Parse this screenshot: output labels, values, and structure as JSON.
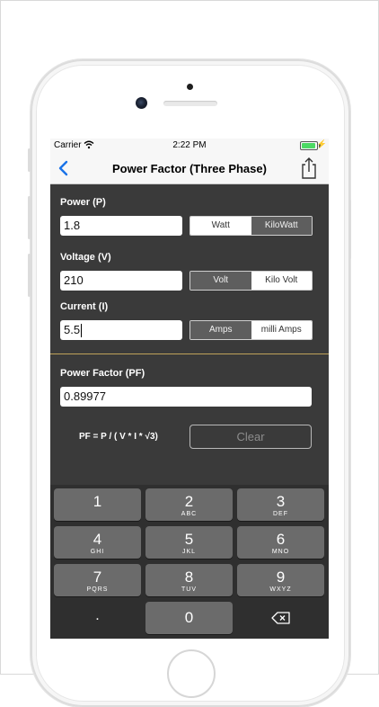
{
  "status_bar": {
    "carrier": "Carrier",
    "time": "2:22 PM",
    "wifi_icon": "wifi-icon",
    "battery_icon": "battery-charging-icon"
  },
  "navbar": {
    "title": "Power Factor (Three Phase)",
    "back_icon": "chevron-left-icon",
    "share_icon": "share-icon",
    "tint_color": "#1a73e8"
  },
  "power": {
    "label": "Power (P)",
    "value": "1.8",
    "units": [
      "Watt",
      "KiloWatt"
    ],
    "selected_unit": "Watt"
  },
  "voltage": {
    "label": "Voltage (V)",
    "value": "210",
    "units": [
      "Volt",
      "Kilo Volt"
    ],
    "selected_unit": "Kilo Volt"
  },
  "current": {
    "label": "Current (I)",
    "value": "5.5",
    "units": [
      "Amps",
      "milli Amps"
    ],
    "selected_unit": "milli Amps"
  },
  "result": {
    "label": "Power Factor (PF)",
    "value": "0.89977"
  },
  "formula": "PF = P / ( V * I * √3)",
  "clear_label": "Clear",
  "keypad": {
    "keys": [
      {
        "num": "1",
        "letters": ""
      },
      {
        "num": "2",
        "letters": "ABC"
      },
      {
        "num": "3",
        "letters": "DEF"
      },
      {
        "num": "4",
        "letters": "GHI"
      },
      {
        "num": "5",
        "letters": "JKL"
      },
      {
        "num": "6",
        "letters": "MNO"
      },
      {
        "num": "7",
        "letters": "PQRS"
      },
      {
        "num": "8",
        "letters": "TUV"
      },
      {
        "num": "9",
        "letters": "WXYZ"
      },
      {
        "num": ".",
        "letters": ""
      },
      {
        "num": "0",
        "letters": ""
      }
    ],
    "backspace_icon": "backspace-icon"
  },
  "colors": {
    "app_background": "#3a3a3a",
    "divider": "#bfa35a",
    "key": "#6b6b6b",
    "keyboard_background": "#2f2f2f"
  }
}
